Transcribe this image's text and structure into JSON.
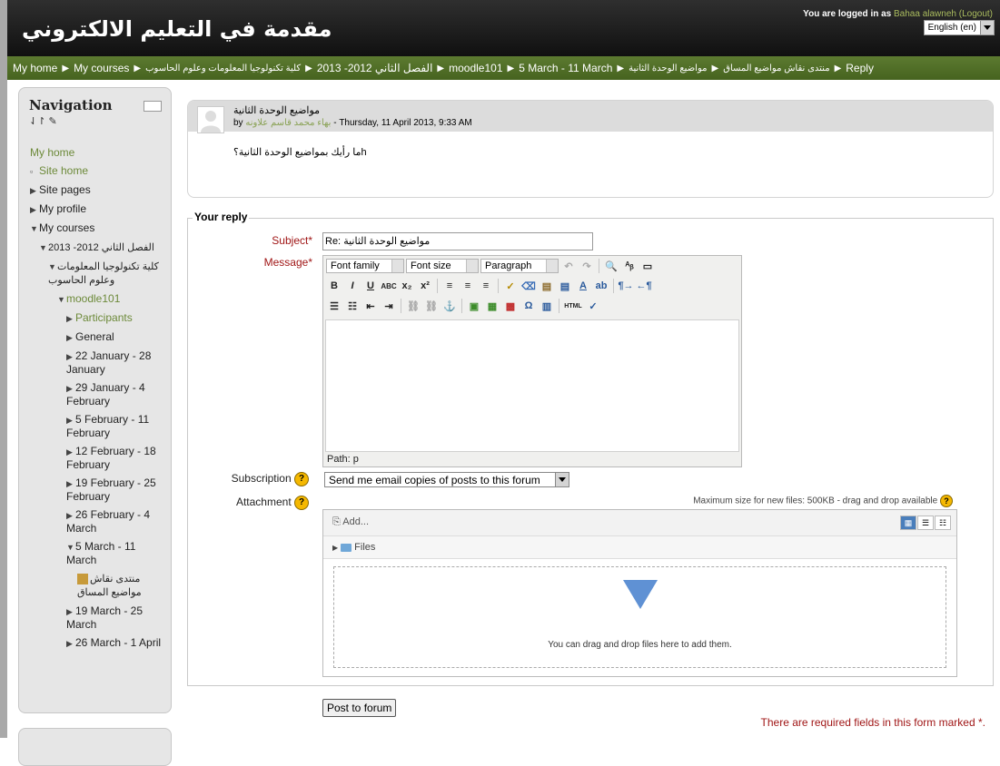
{
  "header": {
    "site_title": "مقدمة في التعليم الالكتروني",
    "login_prefix": "You are logged in as",
    "user_name": "Bahaa alawneh",
    "logout_text": "(Logout)",
    "language": "English (en)"
  },
  "breadcrumb": [
    "My home",
    "My courses",
    "كلية تكنولوجيا المعلومات وعلوم الحاسوب",
    "الفصل الثاني 2012- 2013",
    "moodle101",
    "5 March - 11 March",
    "مواضيع الوحدة الثانية",
    "منتدى نقاش مواضيع المساق",
    "Reply"
  ],
  "navigation": {
    "title": "Navigation",
    "tools": "⇃↾ ✎",
    "items": [
      {
        "label": "My home"
      },
      {
        "label": "Site home"
      },
      {
        "label": "Site pages"
      },
      {
        "label": "My profile"
      },
      {
        "label": "My courses"
      },
      {
        "label": "الفصل الثاني 2012- 2013"
      },
      {
        "label": "كلية تكنولوجيا المعلومات وعلوم الحاسوب"
      },
      {
        "label": "moodle101"
      },
      {
        "label": "Participants"
      },
      {
        "label": "General"
      },
      {
        "label": "22 January - 28 January"
      },
      {
        "label": "29 January - 4 February"
      },
      {
        "label": "5 February - 11 February"
      },
      {
        "label": "12 February - 18 February"
      },
      {
        "label": "19 February - 25 February"
      },
      {
        "label": "26 February - 4 March"
      },
      {
        "label": "5 March - 11 March"
      },
      {
        "label": "منتدى نقاش مواضيع المساق"
      },
      {
        "label": "19 March - 25 March"
      },
      {
        "label": "26 March - 1 April"
      }
    ]
  },
  "post": {
    "subject": "مواضيع الوحدة الثانية",
    "by": "by",
    "author": "بهاء محمد قاسم علاونه",
    "date": "- Thursday, 11 April 2013, 9:33 AM",
    "body": "ما رأيك بمواضيع الوحدة الثانية؟h"
  },
  "form": {
    "legend": "Your reply",
    "subject_label": "Subject",
    "subject_value": "Re: مواضيع الوحدة الثانية",
    "message_label": "Message",
    "editor": {
      "font_family": "Font family",
      "font_size": "Font size",
      "paragraph": "Paragraph",
      "path": "Path: p"
    },
    "subscription_label": "Subscription",
    "subscription_value": "Send me email copies of posts to this forum",
    "attachment_label": "Attachment",
    "max_size": "Maximum size for new files: 500KB - drag and drop available",
    "add_label": "Add...",
    "files_label": "Files",
    "drop_text": "You can drag and drop files here to add them.",
    "submit": "Post to forum",
    "required_note": "There are required fields in this form marked"
  },
  "colors": {
    "navbar_green": "#4f6e25",
    "link_green": "#6d8a3a",
    "required_red": "#a01616"
  }
}
